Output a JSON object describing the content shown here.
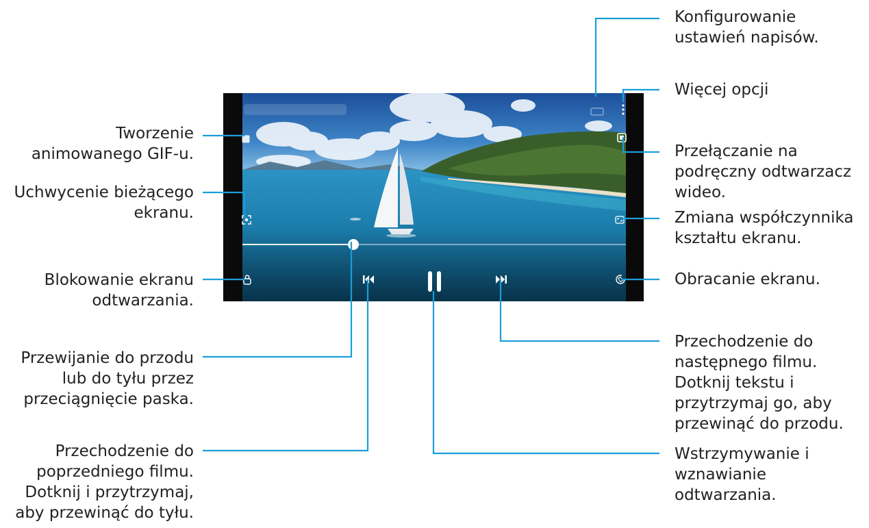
{
  "player": {
    "progress": 0.29,
    "icons": {
      "gif": "gif-icon",
      "capture": "screen-capture-icon",
      "lock": "lock-icon",
      "previous": "skip-previous-icon",
      "pause": "pause-icon",
      "next": "skip-next-icon",
      "rotate": "rotate-screen-icon",
      "ratio": "aspect-ratio-icon",
      "popup": "popup-player-icon",
      "more": "more-options-icon",
      "subtitles": "subtitles-settings-icon"
    }
  },
  "labels": {
    "subtitles": [
      "Konfigurowanie",
      "ustawień napisów."
    ],
    "more": [
      "Więcej opcji"
    ],
    "popup": [
      "Przełączanie na",
      "podręczny odtwarzacz",
      "wideo."
    ],
    "ratio": [
      "Zmiana współczynnika",
      "kształtu ekranu."
    ],
    "rotate": [
      "Obracanie ekranu."
    ],
    "next": [
      "Przechodzenie do",
      "następnego filmu.",
      "Dotknij tekstu i",
      "przytrzymaj go, aby",
      "przewinąć do przodu."
    ],
    "pause": [
      "Wstrzymywanie i",
      "wznawianie",
      "odtwarzania."
    ],
    "gif": [
      "Tworzenie",
      "animowanego GIF-u."
    ],
    "capture": [
      "Uchwycenie bieżącego",
      "ekranu."
    ],
    "lock": [
      "Blokowanie ekranu",
      "odtwarzania."
    ],
    "seek": [
      "Przewijanie do przodu",
      "lub do tyłu przez",
      "przeciągnięcie paska."
    ],
    "previous": [
      "Przechodzenie do",
      "poprzedniego filmu.",
      "Dotknij i przytrzymaj,",
      "aby przewinąć do tyłu."
    ]
  }
}
